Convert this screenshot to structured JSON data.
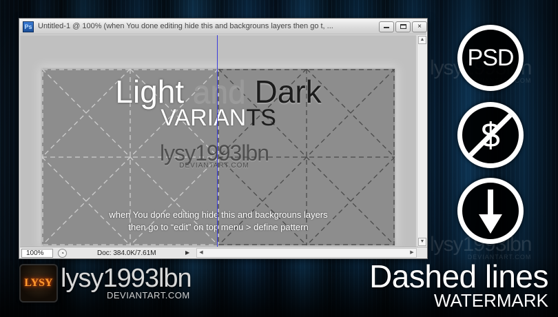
{
  "background": {
    "watermark_name": "lysy1993lbn",
    "watermark_site": "DEVIANTART.COM"
  },
  "window": {
    "app_icon": "Ps",
    "title": "Untitled-1 @ 100% (when You done editing hide this and backgrouns layers then go t, ...",
    "buttons": {
      "minimize": "minimize-icon",
      "maximize": "maximize-icon",
      "close": "×"
    }
  },
  "document": {
    "title_light": "Light",
    "title_and": " and ",
    "title_dark": "Dark",
    "subtitle_light": "VARIAN",
    "subtitle_dark": "TS",
    "watermark_name": "lysy1993lbn",
    "watermark_site": "DEVIANTART.COM",
    "note_line1": "when You done editing hide this and backgrouns layers",
    "note_line2": "then go to “edit” on top menu > define pattern"
  },
  "status": {
    "zoom": "100%",
    "doc_info": "Doc: 384.0K/7.61M",
    "menu_arrow": "▶"
  },
  "badges": {
    "psd": "PSD",
    "free_symbol": "$",
    "download_icon": "arrow-down-icon"
  },
  "branding": {
    "logo_text": "LYSY",
    "name": "lysy1993lbn",
    "site": "DEVIANTART.COM",
    "headline": "Dashed lines",
    "subheadline": "WATERMARK"
  },
  "colors": {
    "guide": "#3a3adb",
    "canvas": "#8d8d8d",
    "window_chrome": "#dedede"
  }
}
